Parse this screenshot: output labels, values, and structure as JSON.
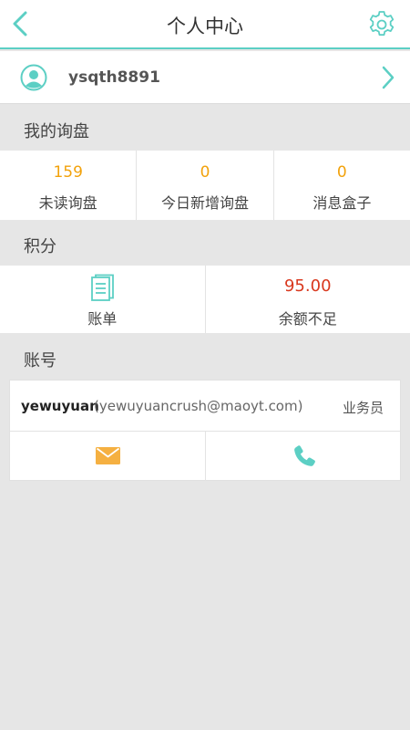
{
  "header": {
    "title": "个人中心",
    "back_icon": "chevron-left-icon",
    "settings_icon": "gear-icon"
  },
  "user": {
    "username": "ysqth8891",
    "avatar_icon": "avatar-icon",
    "chevron_icon": "chevron-right-icon"
  },
  "inquiry": {
    "section_title": "我的询盘",
    "stats": [
      {
        "value": "159",
        "label": "未读询盘"
      },
      {
        "value": "0",
        "label": "今日新增询盘"
      },
      {
        "value": "0",
        "label": "消息盒子"
      }
    ]
  },
  "points": {
    "section_title": "积分",
    "bill_label": "账单",
    "bill_icon": "bill-icon",
    "balance_value": "95.00",
    "balance_label": "余额不足"
  },
  "account": {
    "section_title": "账号",
    "name": "yewuyuan",
    "email": "(yewuyuancrush@maoyt.com)",
    "role": "业务员",
    "mail_icon": "mail-icon",
    "phone_icon": "phone-icon"
  },
  "colors": {
    "accent_teal": "#5ccfc4",
    "stat_orange": "#f2a20c",
    "balance_red": "#d9381e",
    "mail_orange": "#f5b041",
    "background": "#e6e6e6"
  }
}
